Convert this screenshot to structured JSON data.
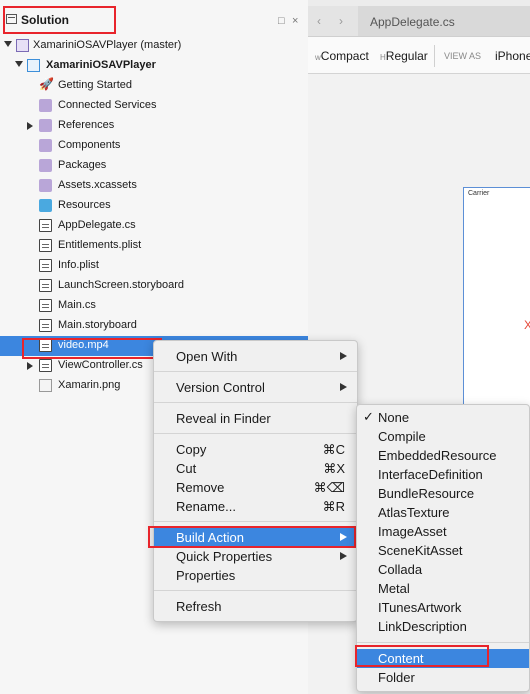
{
  "solution_pad": {
    "title": "Solution",
    "controls": [
      "□",
      "×"
    ],
    "tree": [
      {
        "label": "XamariniOSAVPlayer (master)",
        "icon": "solution-icon",
        "expander": "down"
      },
      {
        "label": "XamariniOSAVPlayer",
        "icon": "project-icon",
        "expander": "down",
        "bold": true
      },
      {
        "label": "Getting Started",
        "icon": "rocket-icon"
      },
      {
        "label": "Connected Services",
        "icon": "folder-icon"
      },
      {
        "label": "References",
        "icon": "folder-icon",
        "expander": "right"
      },
      {
        "label": "Components",
        "icon": "folder-icon"
      },
      {
        "label": "Packages",
        "icon": "folder-icon"
      },
      {
        "label": "Assets.xcassets",
        "icon": "folder-icon"
      },
      {
        "label": "Resources",
        "icon": "folder-blue-icon"
      },
      {
        "label": "AppDelegate.cs",
        "icon": "csharp-file-icon"
      },
      {
        "label": "Entitlements.plist",
        "icon": "plist-file-icon"
      },
      {
        "label": "Info.plist",
        "icon": "plist-file-icon"
      },
      {
        "label": "LaunchScreen.storyboard",
        "icon": "storyboard-file-icon"
      },
      {
        "label": "Main.cs",
        "icon": "csharp-file-icon"
      },
      {
        "label": "Main.storyboard",
        "icon": "storyboard-file-icon"
      },
      {
        "label": "video.mp4",
        "icon": "file-icon",
        "selected": true
      },
      {
        "label": "ViewController.cs",
        "icon": "csharp-file-icon",
        "expander": "right"
      },
      {
        "label": "Xamarin.png",
        "icon": "image-file-icon"
      }
    ]
  },
  "editor": {
    "tab_label": "AppDelegate.cs",
    "back_glyph": "‹",
    "forward_glyph": "›",
    "size_class_w_prefix": "w",
    "size_class_w": "Compact",
    "size_class_h_prefix": "H",
    "size_class_h": "Regular",
    "view_as_label": "VIEW AS",
    "device": "iPhone",
    "carrier_text": "Carrier",
    "marker": "X"
  },
  "context_menu": {
    "items": [
      {
        "label": "Open With",
        "submenu": true
      },
      {
        "label": "Version Control",
        "submenu": true
      },
      {
        "label": "Reveal in Finder"
      },
      {
        "label": "Copy",
        "shortcut": "⌘C"
      },
      {
        "label": "Cut",
        "shortcut": "⌘X"
      },
      {
        "label": "Remove",
        "shortcut": "⌘⌫"
      },
      {
        "label": "Rename...",
        "shortcut": "⌘R"
      },
      {
        "label": "Build Action",
        "submenu": true,
        "highlighted": true
      },
      {
        "label": "Quick Properties",
        "submenu": true
      },
      {
        "label": "Properties"
      },
      {
        "label": "Refresh"
      }
    ]
  },
  "build_action_menu": {
    "items": [
      {
        "label": "None",
        "checked": true
      },
      {
        "label": "Compile"
      },
      {
        "label": "EmbeddedResource"
      },
      {
        "label": "InterfaceDefinition"
      },
      {
        "label": "BundleResource"
      },
      {
        "label": "AtlasTexture"
      },
      {
        "label": "ImageAsset"
      },
      {
        "label": "SceneKitAsset"
      },
      {
        "label": "Collada"
      },
      {
        "label": "Metal"
      },
      {
        "label": "ITunesArtwork"
      },
      {
        "label": "LinkDescription"
      },
      {
        "label": "Content",
        "highlighted": true
      },
      {
        "label": "Folder"
      }
    ],
    "check_glyph": "✓"
  },
  "colors": {
    "highlight": "#3c86df",
    "annotation_box": "#e8242b"
  }
}
